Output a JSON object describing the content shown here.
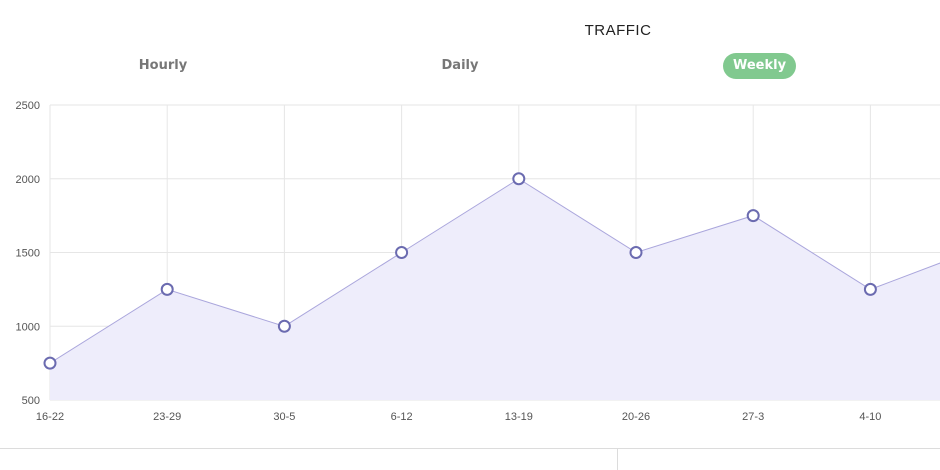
{
  "title": "TRAFFIC",
  "tabs": [
    {
      "label": "Hourly",
      "active": false
    },
    {
      "label": "Daily",
      "active": false
    },
    {
      "label": "Weekly",
      "active": true
    }
  ],
  "colors": {
    "accent": "#81c98f",
    "line": "#aaa6dc",
    "fill": "#eeedfb",
    "point_stroke": "#6b6bb0",
    "grid": "#e6e6e6"
  },
  "chart_data": {
    "type": "area",
    "title": "",
    "xlabel": "",
    "ylabel": "",
    "categories": [
      "16-22",
      "23-29",
      "30-5",
      "6-12",
      "13-19",
      "20-26",
      "27-3",
      "4-10"
    ],
    "values": [
      750,
      1250,
      1000,
      1500,
      2000,
      1500,
      1750,
      1250,
      1550
    ],
    "ylim": [
      500,
      2500
    ],
    "yticks": [
      500,
      1000,
      1500,
      2000,
      2500
    ],
    "grid": true,
    "legend": "none"
  }
}
